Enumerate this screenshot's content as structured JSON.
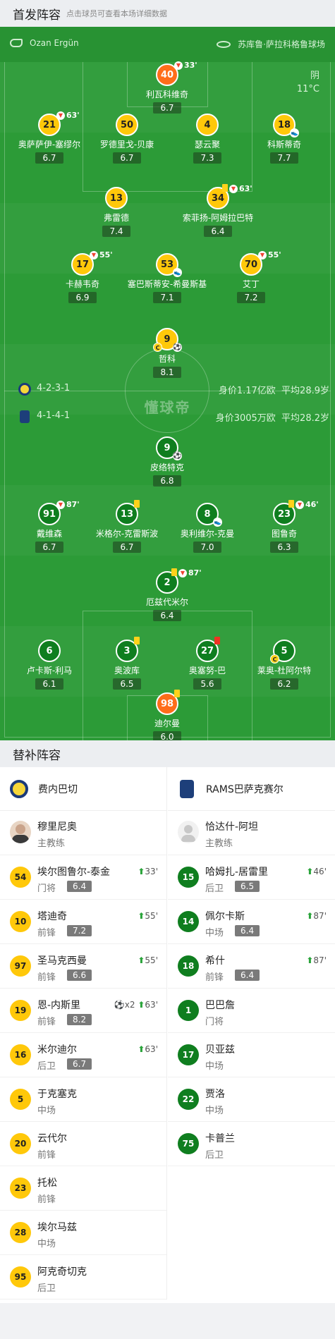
{
  "header": {
    "title": "首发阵容",
    "subtitle": "点击球员可查看本场详细数据"
  },
  "match": {
    "referee": "Ozan Ergün",
    "venue": "苏库鲁·萨拉科格鲁球场",
    "weather": "阴",
    "temperature": "11°C",
    "watermark": "懂球帝"
  },
  "home": {
    "name": "费内巴切",
    "formation": "4-2-3-1",
    "value": "身价1.17亿欧",
    "age": "平均28.9岁",
    "color": "#ffc80a",
    "players": [
      {
        "num": "40",
        "name": "利瓦科维奇",
        "rating": "6.7",
        "sub": "33'",
        "gk": true
      },
      {
        "num": "21",
        "name": "奥萨萨伊-塞缪尔",
        "rating": "6.7",
        "sub": "63'"
      },
      {
        "num": "50",
        "name": "罗德里戈-贝康",
        "rating": "6.7"
      },
      {
        "num": "4",
        "name": "瑟云聚",
        "rating": "7.3"
      },
      {
        "num": "18",
        "name": "科斯蒂奇",
        "rating": "7.7",
        "assist": true
      },
      {
        "num": "13",
        "name": "弗雷德",
        "rating": "7.4"
      },
      {
        "num": "34",
        "name": "索菲扬-阿姆拉巴特",
        "rating": "6.4",
        "sub": "63'",
        "yellow": true
      },
      {
        "num": "17",
        "name": "卡赫韦奇",
        "rating": "6.9",
        "sub": "55'"
      },
      {
        "num": "53",
        "name": "塞巴斯蒂安-希曼斯基",
        "rating": "7.1",
        "assist": true
      },
      {
        "num": "70",
        "name": "艾丁",
        "rating": "7.2",
        "sub": "55'"
      },
      {
        "num": "9",
        "name": "哲科",
        "rating": "8.1",
        "captain": true,
        "goal": true
      }
    ]
  },
  "away": {
    "name": "RAMS巴萨克赛尔",
    "formation": "4-1-4-1",
    "value": "身价3005万欧",
    "age": "平均28.2岁",
    "color": "#0f7e1f",
    "players": [
      {
        "num": "9",
        "name": "皮络特克",
        "rating": "6.8",
        "goal": true
      },
      {
        "num": "91",
        "name": "戴维森",
        "rating": "6.7",
        "sub": "87'"
      },
      {
        "num": "13",
        "name": "米格尔-克雷斯波",
        "rating": "6.7",
        "yellow": true
      },
      {
        "num": "8",
        "name": "奥利维尔-克曼",
        "rating": "7.0",
        "assist": true
      },
      {
        "num": "23",
        "name": "图鲁奇",
        "rating": "6.3",
        "sub": "46'",
        "yellow": true
      },
      {
        "num": "2",
        "name": "厄兹代米尔",
        "rating": "6.4",
        "sub": "87'",
        "yellow": true
      },
      {
        "num": "6",
        "name": "卢卡斯-利马",
        "rating": "6.1"
      },
      {
        "num": "3",
        "name": "奥波库",
        "rating": "6.5",
        "yellow": true
      },
      {
        "num": "27",
        "name": "奥塞努-巴",
        "rating": "5.6",
        "red": true
      },
      {
        "num": "5",
        "name": "莱奥-杜阿尔特",
        "rating": "6.2",
        "captain": true
      },
      {
        "num": "98",
        "name": "迪尔曼",
        "rating": "6.0",
        "yellow": true,
        "gk": true
      }
    ]
  },
  "subs": {
    "title": "替补阵容",
    "home_coach": {
      "name": "穆里尼奥",
      "role": "主教练"
    },
    "away_coach": {
      "name": "恰达什-阿坦",
      "role": "主教练"
    },
    "home": [
      {
        "num": "54",
        "name": "埃尔图鲁尔-泰金",
        "pos": "门将",
        "rating": "6.4",
        "ev": "33'"
      },
      {
        "num": "10",
        "name": "塔迪奇",
        "pos": "前锋",
        "rating": "7.2",
        "ev": "55'"
      },
      {
        "num": "97",
        "name": "圣马克西曼",
        "pos": "前锋",
        "rating": "6.6",
        "ev": "55'"
      },
      {
        "num": "19",
        "name": "恩-内斯里",
        "pos": "前锋",
        "rating": "8.2",
        "ev": "63'",
        "goals": "x2"
      },
      {
        "num": "16",
        "name": "米尔迪尔",
        "pos": "后卫",
        "rating": "6.7",
        "ev": "63'"
      },
      {
        "num": "5",
        "name": "于克塞克",
        "pos": "中场"
      },
      {
        "num": "20",
        "name": "云代尔",
        "pos": "前锋"
      },
      {
        "num": "23",
        "name": "托松",
        "pos": "前锋"
      },
      {
        "num": "28",
        "name": "埃尔马兹",
        "pos": "中场"
      },
      {
        "num": "95",
        "name": "阿克奇切克",
        "pos": "后卫"
      }
    ],
    "away": [
      {
        "num": "15",
        "name": "哈姆扎-居雷里",
        "pos": "后卫",
        "rating": "6.5",
        "ev": "46'"
      },
      {
        "num": "14",
        "name": "佩尔卡斯",
        "pos": "中场",
        "rating": "6.4",
        "ev": "87'"
      },
      {
        "num": "18",
        "name": "希什",
        "pos": "前锋",
        "rating": "6.4",
        "ev": "87'"
      },
      {
        "num": "1",
        "name": "巴巴詹",
        "pos": "门将"
      },
      {
        "num": "17",
        "name": "贝亚兹",
        "pos": "中场"
      },
      {
        "num": "22",
        "name": "贾洛",
        "pos": "中场"
      },
      {
        "num": "75",
        "name": "卡普兰",
        "pos": "后卫"
      }
    ]
  }
}
